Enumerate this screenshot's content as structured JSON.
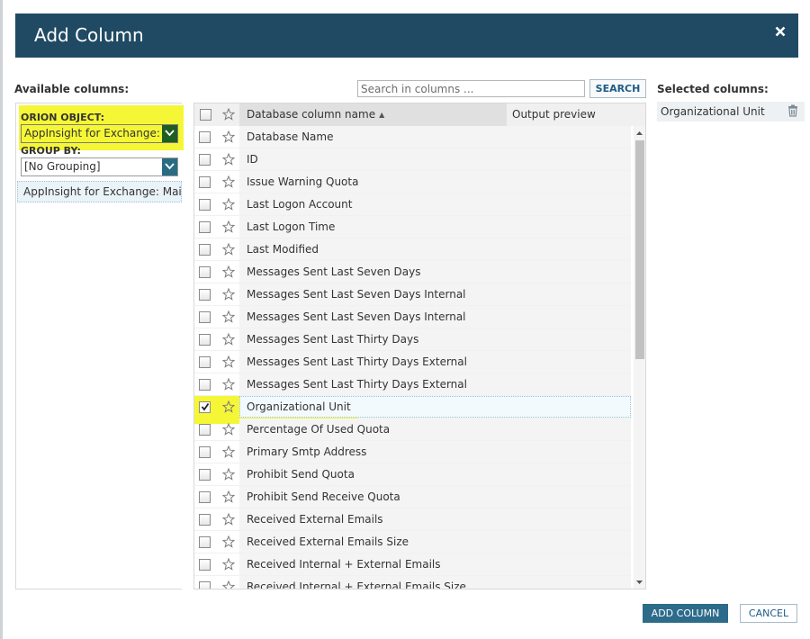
{
  "dialog": {
    "title": "Add Column"
  },
  "available": {
    "label": "Available columns:",
    "search_placeholder": "Search in columns ...",
    "search_button": "SEARCH"
  },
  "left": {
    "orion_object_label": "ORION OBJECT:",
    "orion_object_value": "AppInsight for Exchange: M",
    "group_by_label": "GROUP BY:",
    "group_by_value": "[No Grouping]",
    "object_item": "AppInsight for Exchange: Mai..."
  },
  "table": {
    "header_name": "Database column name",
    "header_preview": "Output preview",
    "rows": [
      {
        "label": "Database Name",
        "checked": false
      },
      {
        "label": "ID",
        "checked": false
      },
      {
        "label": "Issue Warning Quota",
        "checked": false
      },
      {
        "label": "Last Logon Account",
        "checked": false
      },
      {
        "label": "Last Logon Time",
        "checked": false
      },
      {
        "label": "Last Modified",
        "checked": false
      },
      {
        "label": "Messages Sent Last Seven Days",
        "checked": false
      },
      {
        "label": "Messages Sent Last Seven Days Internal",
        "checked": false
      },
      {
        "label": "Messages Sent Last Seven Days Internal",
        "checked": false
      },
      {
        "label": "Messages Sent Last Thirty Days",
        "checked": false
      },
      {
        "label": "Messages Sent Last Thirty Days External",
        "checked": false
      },
      {
        "label": "Messages Sent Last Thirty Days External",
        "checked": false
      },
      {
        "label": "Organizational Unit",
        "checked": true
      },
      {
        "label": "Percentage Of Used Quota",
        "checked": false
      },
      {
        "label": "Primary Smtp Address",
        "checked": false
      },
      {
        "label": "Prohibit Send Quota",
        "checked": false
      },
      {
        "label": "Prohibit Send Receive Quota",
        "checked": false
      },
      {
        "label": "Received External Emails",
        "checked": false
      },
      {
        "label": "Received External Emails Size",
        "checked": false
      },
      {
        "label": "Received Internal + External Emails",
        "checked": false
      },
      {
        "label": "Received Internal + External Emails Size",
        "checked": false
      }
    ]
  },
  "selected": {
    "label": "Selected columns:",
    "items": [
      "Organizational Unit"
    ]
  },
  "footer": {
    "add_button": "ADD COLUMN",
    "cancel_button": "CANCEL"
  },
  "colors": {
    "header_bg": "#204a64",
    "highlight": "#f5f736",
    "primary_button": "#2d6b8a"
  }
}
